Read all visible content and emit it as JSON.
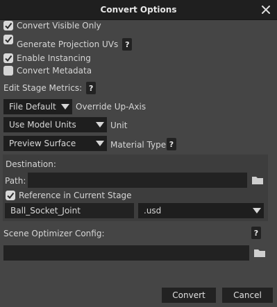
{
  "window": {
    "title": "Convert Options"
  },
  "options": {
    "convert_visible_only": {
      "label": "Convert Visible Only",
      "checked": true
    },
    "generate_projection_uvs": {
      "label": "Generate Projection UVs",
      "checked": true
    },
    "enable_instancing": {
      "label": "Enable Instancing",
      "checked": true
    },
    "convert_metadata": {
      "label": "Convert Metadata",
      "checked": false
    }
  },
  "help_glyph": "?",
  "stage_metrics": {
    "label": "Edit Stage Metrics:",
    "up_axis": {
      "value": "File Default",
      "label": "Override Up-Axis"
    },
    "unit": {
      "value": "Use Model Units",
      "label": "Unit"
    }
  },
  "material": {
    "value": "Preview Surface",
    "label": "Material Type"
  },
  "destination": {
    "label": "Destination:",
    "path_label": "Path:",
    "path_value": "",
    "reference": {
      "label": "Reference in Current Stage",
      "checked": true
    },
    "name_value": "Ball_Socket_Joint",
    "extension": ".usd"
  },
  "scene_optimizer": {
    "label": "Scene Optimizer Config:",
    "path_value": ""
  },
  "buttons": {
    "convert": "Convert",
    "cancel": "Cancel"
  }
}
